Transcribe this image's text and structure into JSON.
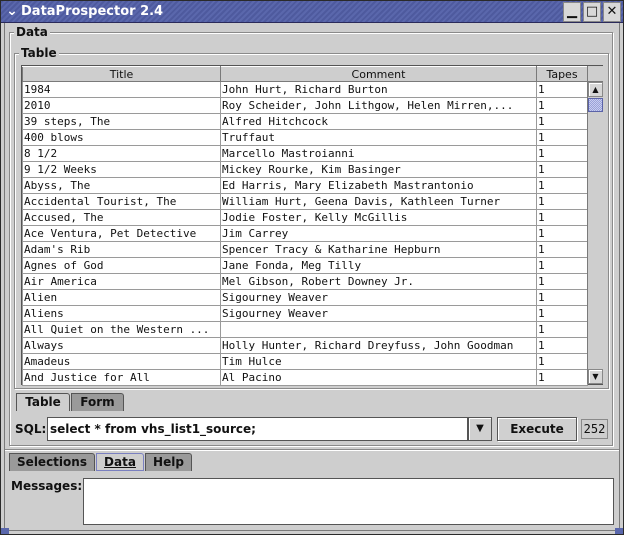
{
  "window": {
    "title": "DataProspector 2.4",
    "menu_icon": "chevron-down-icon",
    "controls": {
      "minimize": "▁",
      "maximize": "□",
      "close": "✕"
    }
  },
  "data_group": {
    "label": "Data"
  },
  "table_group": {
    "label": "Table"
  },
  "table": {
    "columns": [
      "Title",
      "Comment",
      "Tapes"
    ],
    "rows": [
      [
        "1984",
        "John Hurt, Richard Burton",
        "1"
      ],
      [
        "2010",
        "Roy Scheider, John Lithgow, Helen Mirren,...",
        "1"
      ],
      [
        "39 steps, The",
        "Alfred Hitchcock",
        "1"
      ],
      [
        "400 blows",
        "Truffaut",
        "1"
      ],
      [
        "8 1/2",
        "Marcello Mastroianni",
        "1"
      ],
      [
        "9 1/2 Weeks",
        "Mickey Rourke, Kim Basinger",
        "1"
      ],
      [
        "Abyss, The",
        "Ed Harris, Mary Elizabeth Mastrantonio",
        "1"
      ],
      [
        "Accidental Tourist, The",
        "William Hurt, Geena Davis, Kathleen Turner",
        "1"
      ],
      [
        "Accused, The",
        "Jodie Foster, Kelly McGillis",
        "1"
      ],
      [
        "Ace Ventura, Pet Detective",
        "Jim Carrey",
        "1"
      ],
      [
        "Adam's Rib",
        "Spencer Tracy & Katharine Hepburn",
        "1"
      ],
      [
        "Agnes of God",
        "Jane Fonda, Meg Tilly",
        "1"
      ],
      [
        "Air America",
        "Mel Gibson, Robert Downey Jr.",
        "1"
      ],
      [
        "Alien",
        "Sigourney Weaver",
        "1"
      ],
      [
        "Aliens",
        "Sigourney Weaver",
        "1"
      ],
      [
        "All Quiet on the Western ...",
        "",
        "1"
      ],
      [
        "Always",
        "Holly Hunter, Richard Dreyfuss, John Goodman",
        "1"
      ],
      [
        "Amadeus",
        "Tim Hulce",
        "1"
      ],
      [
        "And Justice for All",
        "Al Pacino",
        "1"
      ]
    ],
    "scroll_up": "▲",
    "scroll_down": "▼"
  },
  "view_tabs": [
    {
      "label": "Table",
      "active": true
    },
    {
      "label": "Form",
      "active": false
    }
  ],
  "sql": {
    "label": "SQL:",
    "value": "select * from vhs_list1_source;",
    "dropdown_arrow": "▼",
    "execute_label": "Execute",
    "row_count": "252"
  },
  "bottom_tabs": [
    {
      "label": "Selections",
      "active": false
    },
    {
      "label": "Data",
      "active": true
    },
    {
      "label": "Help",
      "active": false
    }
  ],
  "messages": {
    "label": "Messages:",
    "value": ""
  }
}
